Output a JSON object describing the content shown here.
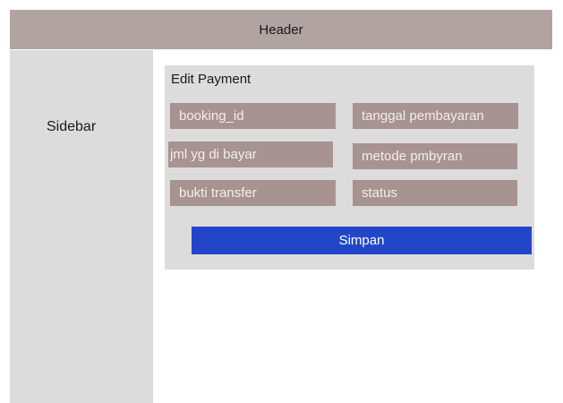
{
  "header": {
    "title": "Header"
  },
  "sidebar": {
    "label": "Sidebar"
  },
  "form": {
    "title": "Edit Payment",
    "fields": {
      "booking_id": "booking_id",
      "tanggal_pembayaran": "tanggal pembayaran",
      "jml_yg_di_bayar": "jml yg di bayar",
      "metode_pmbyran": "metode pmbyran",
      "bukti_transfer": "bukti transfer",
      "status": "status"
    },
    "save_label": "Simpan"
  },
  "colors": {
    "header_bg": "#b0a3a1",
    "panel_bg": "#dcdcdc",
    "field_bg": "#a79391",
    "button_bg": "#2346c9"
  }
}
